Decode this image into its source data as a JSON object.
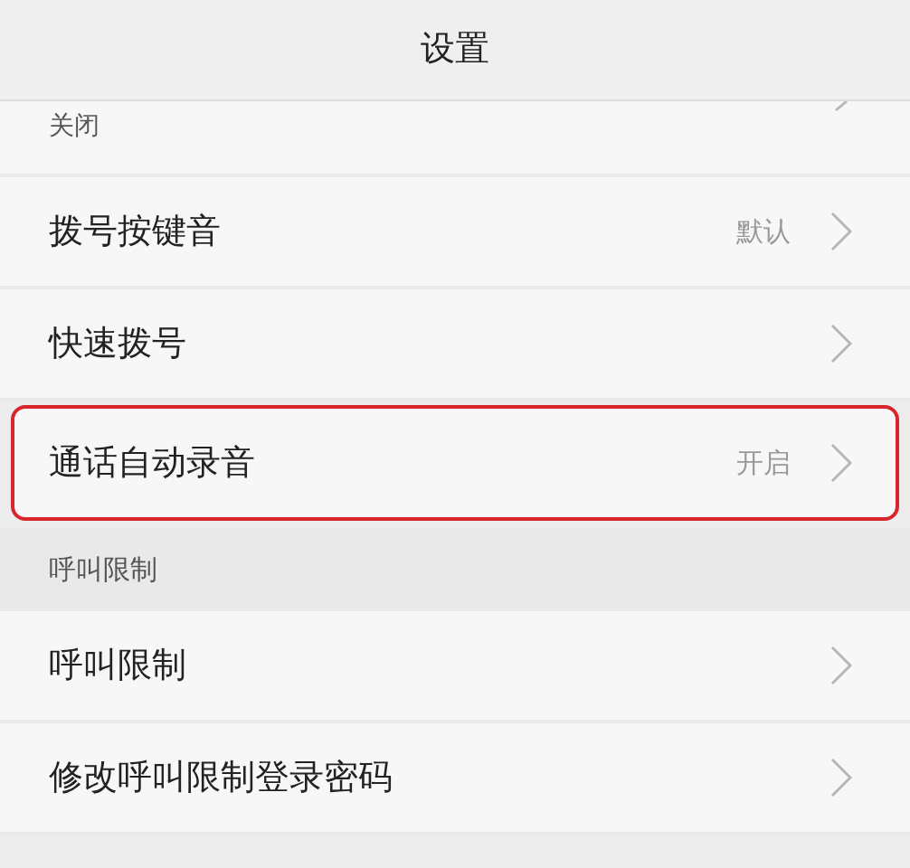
{
  "header": {
    "title": "设置"
  },
  "rows": [
    {
      "kind": "partial",
      "subtitle": "关闭"
    },
    {
      "kind": "row",
      "label": "拨号按键音",
      "value": "默认",
      "highlighted": false
    },
    {
      "kind": "row",
      "label": "快速拨号",
      "highlighted": false
    },
    {
      "kind": "row",
      "label": "通话自动录音",
      "value": "开启",
      "highlighted": true
    },
    {
      "kind": "section",
      "label": "呼叫限制"
    },
    {
      "kind": "row",
      "label": "呼叫限制",
      "highlighted": false
    },
    {
      "kind": "row",
      "label": "修改呼叫限制登录密码",
      "highlighted": false
    }
  ]
}
